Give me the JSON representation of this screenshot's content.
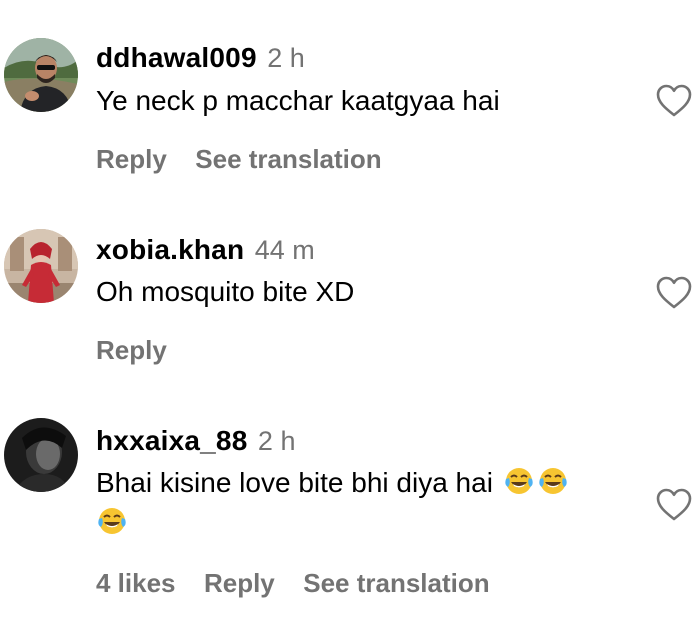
{
  "comments": [
    {
      "username": "ddhawal009",
      "time": "2 h",
      "text": "Ye neck p macchar kaatgyaa hai",
      "emoji_text": "",
      "actions": {
        "likes": "",
        "reply": "Reply",
        "translate": "See translation"
      },
      "avatar_icon": "user-avatar-outdoor-sunglasses",
      "liked": false
    },
    {
      "username": "xobia.khan",
      "time": "44 m",
      "text": "Oh mosquito bite XD",
      "emoji_text": "",
      "actions": {
        "likes": "",
        "reply": "Reply",
        "translate": ""
      },
      "avatar_icon": "user-avatar-red-outfit",
      "liked": false
    },
    {
      "username": "hxxaixa_88",
      "time": "2 h",
      "text": "Bhai kisine love bite bhi diya hai",
      "emoji_text": "😂😂😂",
      "actions": {
        "likes": "4 likes",
        "reply": "Reply",
        "translate": "See translation"
      },
      "avatar_icon": "user-avatar-dark",
      "liked": false
    }
  ],
  "colors": {
    "username": "#000000",
    "secondary_text": "#737373",
    "heart_outline": "#737373",
    "background": "#ffffff"
  },
  "icons": {
    "like": "heart-outline-icon",
    "laugh": "face-with-tears-of-joy-emoji"
  }
}
